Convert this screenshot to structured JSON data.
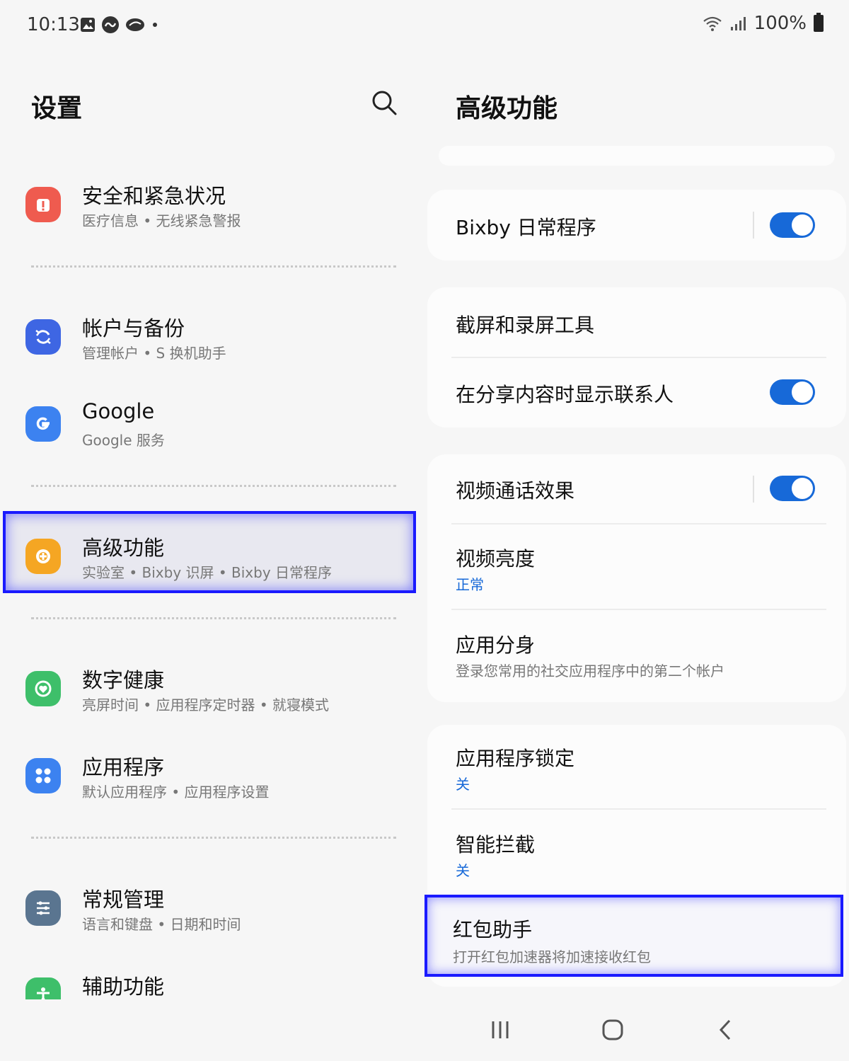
{
  "status_bar": {
    "time": "10:13",
    "battery": "100%"
  },
  "left": {
    "title": "设置",
    "items": [
      {
        "title": "安全和紧急状况",
        "subtitle": "医疗信息 • 无线紧急警报",
        "icon": "alert-icon",
        "color": "#ef5b4f"
      },
      {
        "title": "帐户与备份",
        "subtitle": "管理帐户 • S 换机助手",
        "icon": "sync-icon",
        "color": "#3e66e3"
      },
      {
        "title": "Google",
        "subtitle": "Google 服务",
        "icon": "google-icon",
        "color": "#3c82f0"
      },
      {
        "title": "高级功能",
        "subtitle": "实验室 • Bixby 识屏 • Bixby 日常程序",
        "icon": "advanced-features-icon",
        "color": "#f5a623"
      },
      {
        "title": "数字健康",
        "subtitle": "亮屏时间 • 应用程序定时器 • 就寝模式",
        "icon": "digital-wellbeing-icon",
        "color": "#3ebf6a"
      },
      {
        "title": "应用程序",
        "subtitle": "默认应用程序 • 应用程序设置",
        "icon": "apps-icon",
        "color": "#3c82f0"
      },
      {
        "title": "常规管理",
        "subtitle": "语言和键盘 • 日期和时间",
        "icon": "sliders-icon",
        "color": "#5a7590"
      },
      {
        "title": "辅助功能",
        "subtitle": "",
        "icon": "accessibility-icon",
        "color": "#3ebf6a"
      }
    ]
  },
  "right": {
    "title": "高级功能",
    "rows": {
      "bixby": {
        "title": "Bixby 日常程序",
        "toggle": "on"
      },
      "screenshot": {
        "title": "截屏和录屏工具"
      },
      "share_contacts": {
        "title": "在分享内容时显示联系人",
        "toggle": "on"
      },
      "video_call": {
        "title": "视频通话效果",
        "toggle": "on"
      },
      "video_brightness": {
        "title": "视频亮度",
        "value": "正常"
      },
      "dual_messenger": {
        "title": "应用分身",
        "subtitle": "登录您常用的社交应用程序中的第二个帐户"
      },
      "app_lock": {
        "title": "应用程序锁定",
        "value": "关"
      },
      "smart_block": {
        "title": "智能拦截",
        "value": "关"
      },
      "red_packet": {
        "title": "红包助手",
        "subtitle": "打开红包加速器将加速接收红包"
      }
    }
  },
  "colors": {
    "accent": "#1769d8",
    "highlight": "#1a1aff"
  }
}
